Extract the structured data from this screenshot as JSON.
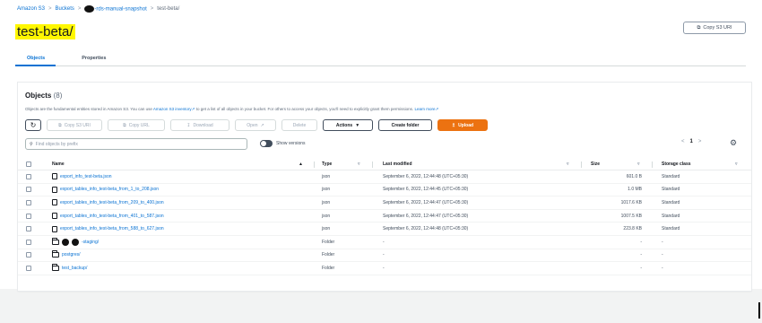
{
  "breadcrumb": {
    "items": [
      "Amazon S3",
      "Buckets",
      "-rds-manual-snapshot",
      "test-beta/"
    ]
  },
  "page": {
    "title": "test-beta/",
    "copy_s3_uri": "Copy S3 URI"
  },
  "tabs": [
    {
      "label": "Objects",
      "active": true
    },
    {
      "label": "Properties",
      "active": false
    }
  ],
  "objects_panel": {
    "heading": "Objects",
    "count": "(8)",
    "description_prefix": "Objects are the fundamental entities stored in Amazon S3. You can use",
    "description_link": "Amazon S3 inventory",
    "description_mid": "to get a list of all objects in your bucket. For others to access your objects, you'll need to explicitly grant them permissions.",
    "description_link2": "Learn more",
    "toolbar": {
      "refresh_icon": "refresh-icon",
      "copy_s3_uri": "Copy S3 URI",
      "copy_url": "Copy URL",
      "download": "Download",
      "open": "Open",
      "delete": "Delete",
      "actions": "Actions",
      "create_folder": "Create folder",
      "upload": "Upload"
    },
    "search_placeholder": "Find objects by prefix",
    "show_versions": "Show versions",
    "pagination": {
      "current_page": "1"
    },
    "columns": [
      "Name",
      "Type",
      "Last modified",
      "Size",
      "Storage class"
    ],
    "rows": [
      {
        "name": "export_info_test-beta.json",
        "kind": "file",
        "type": "json",
        "last_modified": "September 6, 2022, 12:44:48 (UTC+05:30)",
        "size": "601.0 B",
        "storage_class": "Standard"
      },
      {
        "name": "export_tables_info_test-beta_from_1_to_208.json",
        "kind": "file",
        "type": "json",
        "last_modified": "September 6, 2022, 12:44:45 (UTC+05:30)",
        "size": "1.0 MB",
        "storage_class": "Standard"
      },
      {
        "name": "export_tables_info_test-beta_from_209_to_400.json",
        "kind": "file",
        "type": "json",
        "last_modified": "September 6, 2022, 12:44:47 (UTC+05:30)",
        "size": "1017.6 KB",
        "storage_class": "Standard"
      },
      {
        "name": "export_tables_info_test-beta_from_401_to_587.json",
        "kind": "file",
        "type": "json",
        "last_modified": "September 6, 2022, 12:44:47 (UTC+05:30)",
        "size": "1007.5 KB",
        "storage_class": "Standard"
      },
      {
        "name": "export_tables_info_test-beta_from_588_to_627.json",
        "kind": "file",
        "type": "json",
        "last_modified": "September 6, 2022, 12:44:48 (UTC+05:30)",
        "size": "223.8 KB",
        "storage_class": "Standard"
      },
      {
        "name": "-staging/",
        "kind": "folder",
        "redacted": true,
        "type": "Folder",
        "last_modified": "-",
        "size": "-",
        "storage_class": "-"
      },
      {
        "name": "postgres/",
        "kind": "folder",
        "type": "Folder",
        "last_modified": "-",
        "size": "-",
        "storage_class": "-"
      },
      {
        "name": "test_backup/",
        "kind": "folder",
        "type": "Folder",
        "last_modified": "-",
        "size": "-",
        "storage_class": "-"
      }
    ]
  },
  "colors": {
    "link": "#0972d3",
    "primary_button": "#ec7211",
    "title_highlight": "#fff700"
  }
}
